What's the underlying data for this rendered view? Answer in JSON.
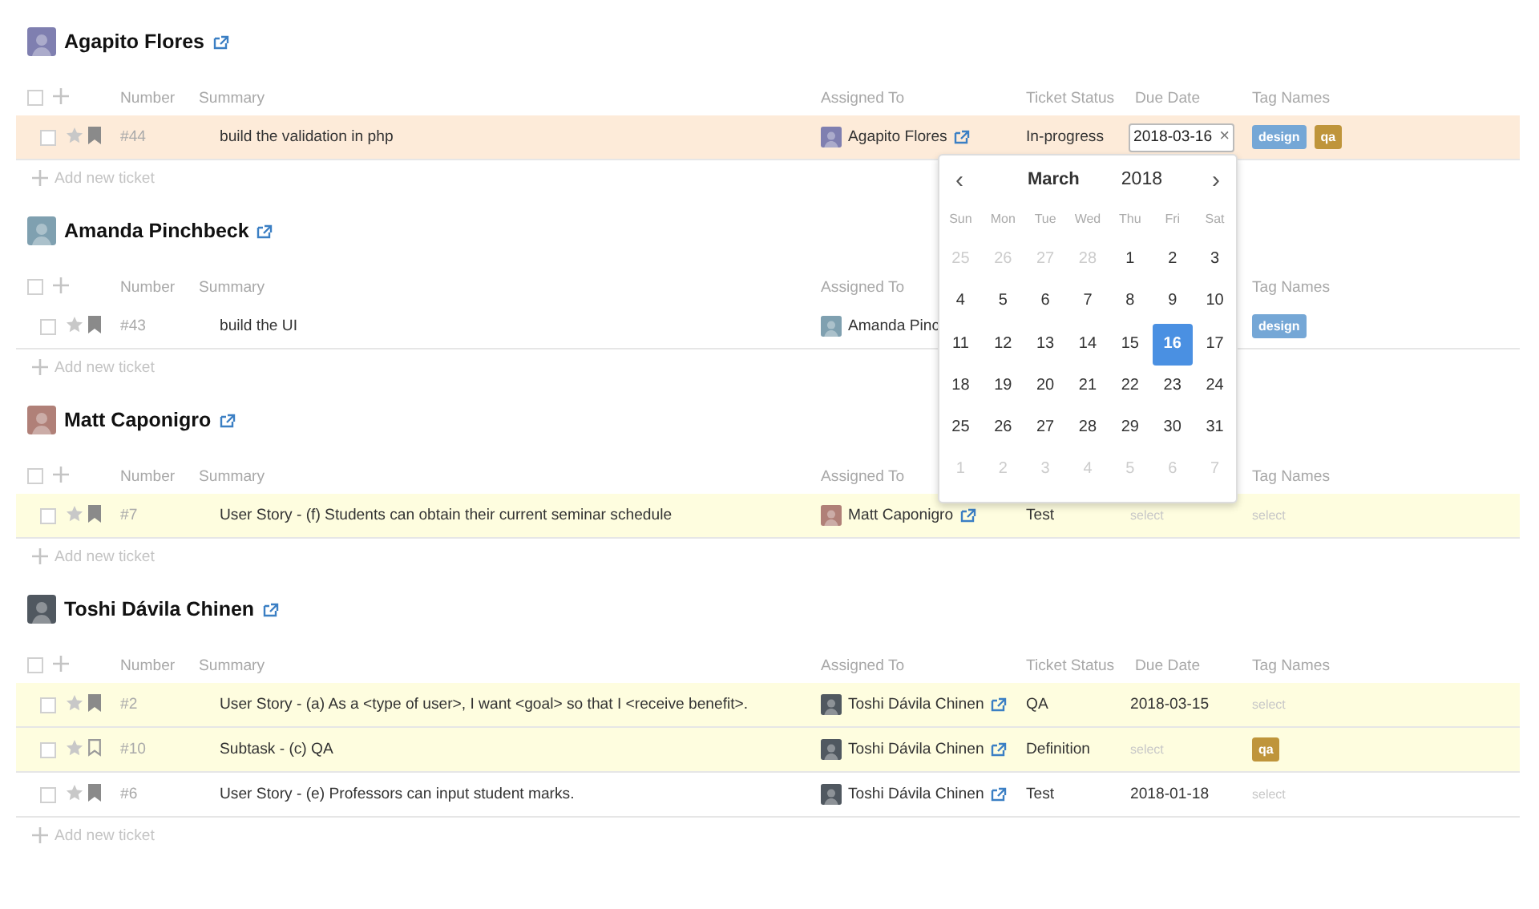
{
  "sections": [
    {
      "name": "Agapito Flores",
      "color": "#7f7fb0",
      "link": true,
      "all_checked": false,
      "columns": {
        "number": "Number",
        "summary": "Summary",
        "assigned_to": "Assigned To",
        "status": "Ticket Status",
        "due_date": "Due Date",
        "tags": "Tag Names"
      },
      "tickets": [
        {
          "number": "#44",
          "summary": "build the validation in php",
          "assignee": "Agapito Flores",
          "assignee_link": true,
          "status": "In-progress",
          "due_date": "2018-03-16",
          "due_editing": true,
          "clear_label": "×",
          "tags": [
            {
              "label": "design",
              "color": "#75a7d6"
            },
            {
              "label": "qa",
              "color": "#bf953b"
            }
          ],
          "checked": false,
          "selected": true,
          "bookmarked": true
        }
      ],
      "add_label": "Add new ticket"
    },
    {
      "name": "Amanda Pinchbeck",
      "color": "#7fa0b0",
      "link": true,
      "all_checked": false,
      "columns": {
        "number": "Number",
        "summary": "Summary",
        "assigned_to": "Assigned To",
        "tags": "Tag Names"
      },
      "tickets": [
        {
          "number": "#43",
          "summary": "build the UI",
          "assignee": "Amanda Pinc",
          "assignee_link": false,
          "tags": [
            {
              "label": "design",
              "color": "#75a7d6"
            }
          ],
          "checked": false,
          "selected": false,
          "flagged": false,
          "bookmarked": true
        }
      ],
      "add_label": "Add new ticket"
    },
    {
      "name": "Matt Caponigro",
      "color": "#b08078",
      "link": true,
      "all_checked": false,
      "columns": {
        "number": "Number",
        "summary": "Summary",
        "assigned_to": "Assigned To",
        "tags": "Tag Names"
      },
      "tickets": [
        {
          "number": "#7",
          "summary": "User Story - (f) Students can obtain their current seminar schedule",
          "assignee": "Matt Caponigro",
          "assignee_link": true,
          "status": "Test",
          "due_placeholder": "select",
          "tags_placeholder": "select",
          "checked": false,
          "selected": false,
          "flagged": true,
          "bookmarked": true
        }
      ],
      "add_label": "Add new ticket"
    },
    {
      "name": "Toshi Dávila Chinen",
      "color": "#505860",
      "link": true,
      "all_checked": false,
      "columns": {
        "number": "Number",
        "summary": "Summary",
        "assigned_to": "Assigned To",
        "status": "Ticket Status",
        "due_date": "Due Date",
        "tags": "Tag Names"
      },
      "tickets": [
        {
          "number": "#2",
          "summary": "User Story - (a) As a <type of user>, I want <goal> so that I <receive benefit>.",
          "assignee": "Toshi Dávila Chinen",
          "assignee_link": true,
          "status": "QA",
          "due_date": "2018-03-15",
          "tags_placeholder": "select",
          "checked": false,
          "selected": false,
          "flagged": true,
          "bookmarked": true
        },
        {
          "number": "#10",
          "summary": "Subtask - (c) QA",
          "assignee": "Toshi Dávila Chinen",
          "assignee_link": true,
          "status": "Definition",
          "due_placeholder": "select",
          "tags": [
            {
              "label": "qa",
              "color": "#bf953b"
            }
          ],
          "checked": false,
          "selected": false,
          "flagged": true,
          "bookmarked": false
        },
        {
          "number": "#6",
          "summary": "User Story - (e) Professors can input student marks.",
          "assignee": "Toshi Dávila Chinen",
          "assignee_link": true,
          "status": "Test",
          "due_date": "2018-01-18",
          "tags_placeholder": "select",
          "checked": false,
          "selected": false,
          "flagged": false,
          "bookmarked": true
        }
      ],
      "add_label": "Add new ticket"
    }
  ],
  "calendar": {
    "prev": "‹",
    "next": "›",
    "month": "March",
    "year": "2018",
    "weekdays": [
      "Sun",
      "Mon",
      "Tue",
      "Wed",
      "Thu",
      "Fri",
      "Sat"
    ],
    "days": [
      {
        "label": "25",
        "outside": true,
        "selected": false
      },
      {
        "label": "26",
        "outside": true,
        "selected": false
      },
      {
        "label": "27",
        "outside": true,
        "selected": false
      },
      {
        "label": "28",
        "outside": true,
        "selected": false
      },
      {
        "label": "1",
        "outside": false,
        "selected": false
      },
      {
        "label": "2",
        "outside": false,
        "selected": false
      },
      {
        "label": "3",
        "outside": false,
        "selected": false
      },
      {
        "label": "4",
        "outside": false,
        "selected": false
      },
      {
        "label": "5",
        "outside": false,
        "selected": false
      },
      {
        "label": "6",
        "outside": false,
        "selected": false
      },
      {
        "label": "7",
        "outside": false,
        "selected": false
      },
      {
        "label": "8",
        "outside": false,
        "selected": false
      },
      {
        "label": "9",
        "outside": false,
        "selected": false
      },
      {
        "label": "10",
        "outside": false,
        "selected": false
      },
      {
        "label": "11",
        "outside": false,
        "selected": false
      },
      {
        "label": "12",
        "outside": false,
        "selected": false
      },
      {
        "label": "13",
        "outside": false,
        "selected": false
      },
      {
        "label": "14",
        "outside": false,
        "selected": false
      },
      {
        "label": "15",
        "outside": false,
        "selected": false
      },
      {
        "label": "16",
        "outside": false,
        "selected": true
      },
      {
        "label": "17",
        "outside": false,
        "selected": false
      },
      {
        "label": "18",
        "outside": false,
        "selected": false
      },
      {
        "label": "19",
        "outside": false,
        "selected": false
      },
      {
        "label": "20",
        "outside": false,
        "selected": false
      },
      {
        "label": "21",
        "outside": false,
        "selected": false
      },
      {
        "label": "22",
        "outside": false,
        "selected": false
      },
      {
        "label": "23",
        "outside": false,
        "selected": false
      },
      {
        "label": "24",
        "outside": false,
        "selected": false
      },
      {
        "label": "25",
        "outside": false,
        "selected": false
      },
      {
        "label": "26",
        "outside": false,
        "selected": false
      },
      {
        "label": "27",
        "outside": false,
        "selected": false
      },
      {
        "label": "28",
        "outside": false,
        "selected": false
      },
      {
        "label": "29",
        "outside": false,
        "selected": false
      },
      {
        "label": "30",
        "outside": false,
        "selected": false
      },
      {
        "label": "31",
        "outside": false,
        "selected": false
      },
      {
        "label": "1",
        "outside": true,
        "selected": false
      },
      {
        "label": "2",
        "outside": true,
        "selected": false
      },
      {
        "label": "3",
        "outside": true,
        "selected": false
      },
      {
        "label": "4",
        "outside": true,
        "selected": false
      },
      {
        "label": "5",
        "outside": true,
        "selected": false
      },
      {
        "label": "6",
        "outside": true,
        "selected": false
      },
      {
        "label": "7",
        "outside": true,
        "selected": false
      }
    ]
  }
}
